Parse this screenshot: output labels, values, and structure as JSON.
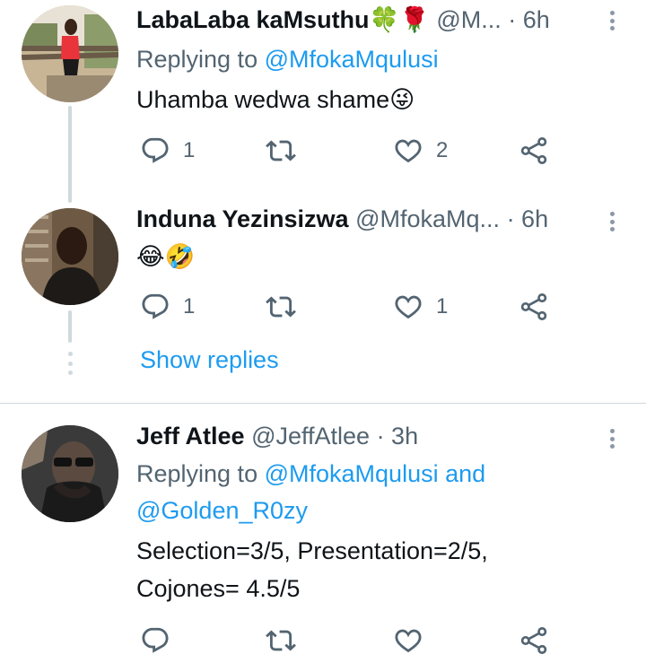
{
  "tweets": [
    {
      "name": "LabaLaba kaMsuthu🍀🌹",
      "handle": "@M...",
      "time": "· 6h",
      "replying_prefix": "Replying to",
      "replying_mentions": "@MfokaMqulusi",
      "text": "Uhamba wedwa shame😜",
      "counts": {
        "replies": "1",
        "retweets": "",
        "likes": "2"
      }
    },
    {
      "name": "Induna Yezinsizwa",
      "handle": "@MfokaMq...",
      "time": "· 6h",
      "text": "😂🤣",
      "counts": {
        "replies": "1",
        "retweets": "",
        "likes": "1"
      }
    },
    {
      "name": "Jeff Atlee",
      "handle": "@JeffAtlee",
      "time": "· 3h",
      "replying_prefix": "Replying to",
      "replying_mentions_line1": "@MfokaMqulusi and",
      "replying_mentions_line2": "@Golden_R0zy",
      "text_line1": "Selection=3/5, Presentation=2/5,",
      "text_line2": "Cojones= 4.5/5",
      "counts": {
        "replies": "",
        "retweets": "",
        "likes": ""
      }
    }
  ],
  "show_replies_label": "Show replies",
  "icons": {
    "reply": "reply-icon",
    "retweet": "retweet-icon",
    "like": "heart-icon",
    "share": "share-icon",
    "more": "more-vertical-icon"
  },
  "colors": {
    "accent": "#1d9bf0",
    "secondary": "#536471",
    "line": "#cfd9de"
  }
}
